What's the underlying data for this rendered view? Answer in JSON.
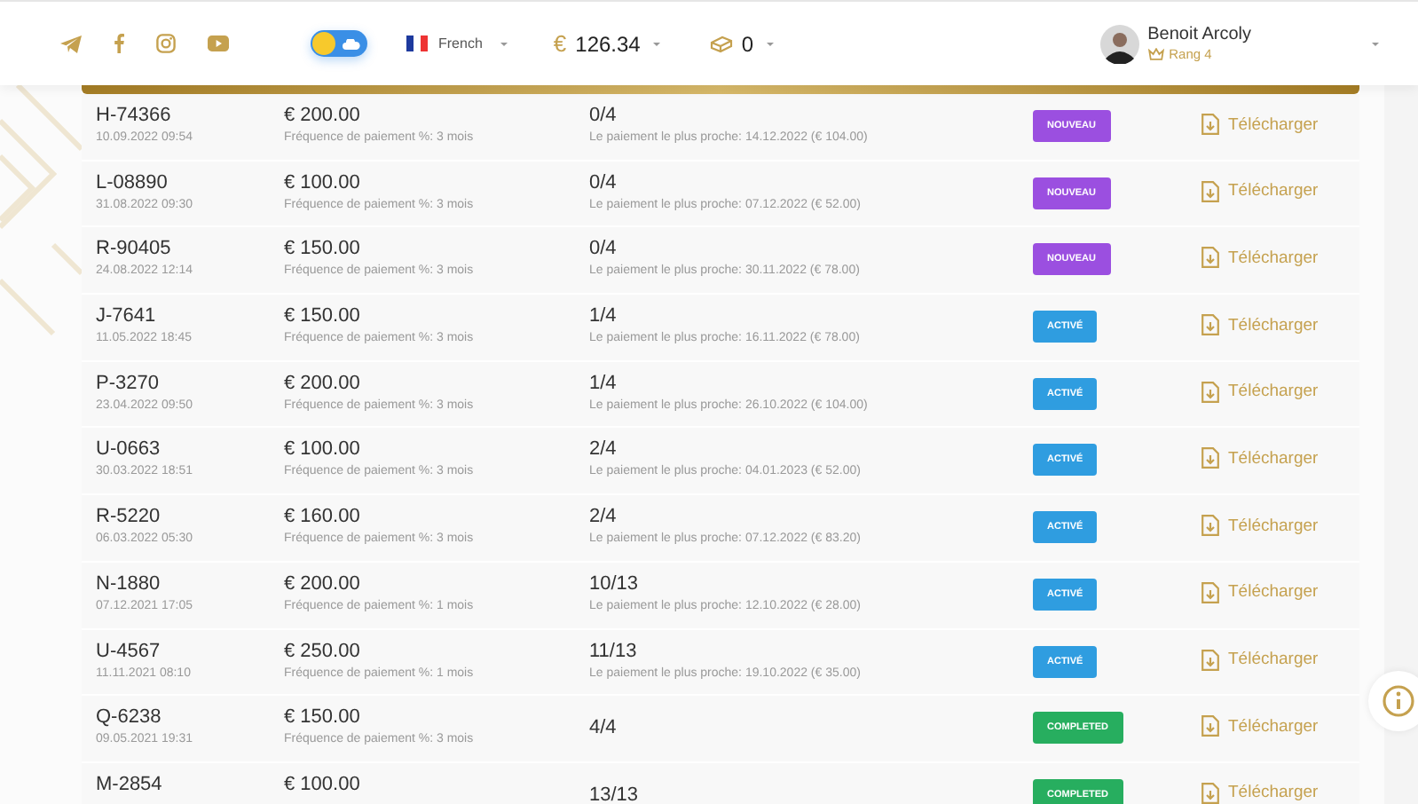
{
  "header": {
    "social": [
      {
        "kind": "telegram"
      },
      {
        "kind": "facebook"
      },
      {
        "kind": "instagram"
      },
      {
        "kind": "youtube"
      }
    ],
    "theme_toggle": {
      "dark": false
    },
    "language": {
      "label": "French"
    },
    "balance": {
      "currency": "€",
      "amount": "126.34"
    },
    "points": {
      "value": "0"
    },
    "user": {
      "name": "Benoit Arcoly",
      "rank": "Rang 4"
    }
  },
  "rows": [
    {
      "id": "H-74366",
      "date": "10.09.2022 09:54",
      "amount": "€ 200.00",
      "frequency": "Fréquence de paiement %: 3 mois",
      "progress": "0/4",
      "next_payment": "Le paiement le plus proche: 14.12.2022 (€ 104.00)",
      "status": {
        "kind": "new",
        "label": "NOUVEAU"
      },
      "download": "Télécharger"
    },
    {
      "id": "L-08890",
      "date": "31.08.2022 09:30",
      "amount": "€ 100.00",
      "frequency": "Fréquence de paiement %: 3 mois",
      "progress": "0/4",
      "next_payment": "Le paiement le plus proche: 07.12.2022 (€ 52.00)",
      "status": {
        "kind": "new",
        "label": "NOUVEAU"
      },
      "download": "Télécharger"
    },
    {
      "id": "R-90405",
      "date": "24.08.2022 12:14",
      "amount": "€ 150.00",
      "frequency": "Fréquence de paiement %: 3 mois",
      "progress": "0/4",
      "next_payment": "Le paiement le plus proche: 30.11.2022 (€ 78.00)",
      "status": {
        "kind": "new",
        "label": "NOUVEAU"
      },
      "download": "Télécharger"
    },
    {
      "id": "J-7641",
      "date": "11.05.2022 18:45",
      "amount": "€ 150.00",
      "frequency": "Fréquence de paiement %: 3 mois",
      "progress": "1/4",
      "next_payment": "Le paiement le plus proche: 16.11.2022 (€ 78.00)",
      "status": {
        "kind": "active",
        "label": "ACTIVÉ"
      },
      "download": "Télécharger"
    },
    {
      "id": "P-3270",
      "date": "23.04.2022 09:50",
      "amount": "€ 200.00",
      "frequency": "Fréquence de paiement %: 3 mois",
      "progress": "1/4",
      "next_payment": "Le paiement le plus proche: 26.10.2022 (€ 104.00)",
      "status": {
        "kind": "active",
        "label": "ACTIVÉ"
      },
      "download": "Télécharger"
    },
    {
      "id": "U-0663",
      "date": "30.03.2022 18:51",
      "amount": "€ 100.00",
      "frequency": "Fréquence de paiement %: 3 mois",
      "progress": "2/4",
      "next_payment": "Le paiement le plus proche: 04.01.2023 (€ 52.00)",
      "status": {
        "kind": "active",
        "label": "ACTIVÉ"
      },
      "download": "Télécharger"
    },
    {
      "id": "R-5220",
      "date": "06.03.2022 05:30",
      "amount": "€ 160.00",
      "frequency": "Fréquence de paiement %: 3 mois",
      "progress": "2/4",
      "next_payment": "Le paiement le plus proche: 07.12.2022 (€ 83.20)",
      "status": {
        "kind": "active",
        "label": "ACTIVÉ"
      },
      "download": "Télécharger"
    },
    {
      "id": "N-1880",
      "date": "07.12.2021 17:05",
      "amount": "€ 200.00",
      "frequency": "Fréquence de paiement %: 1 mois",
      "progress": "10/13",
      "next_payment": "Le paiement le plus proche: 12.10.2022 (€ 28.00)",
      "status": {
        "kind": "active",
        "label": "ACTIVÉ"
      },
      "download": "Télécharger"
    },
    {
      "id": "U-4567",
      "date": "11.11.2021 08:10",
      "amount": "€ 250.00",
      "frequency": "Fréquence de paiement %: 1 mois",
      "progress": "11/13",
      "next_payment": "Le paiement le plus proche: 19.10.2022 (€ 35.00)",
      "status": {
        "kind": "active",
        "label": "ACTIVÉ"
      },
      "download": "Télécharger"
    },
    {
      "id": "Q-6238",
      "date": "09.05.2021 19:31",
      "amount": "€ 150.00",
      "frequency": "Fréquence de paiement %: 3 mois",
      "progress": "4/4",
      "status": {
        "kind": "completed",
        "label": "COMPLETED"
      },
      "download": "Télécharger"
    },
    {
      "id": "M-2854",
      "amount": "€ 100.00",
      "progress": "13/13",
      "status": {
        "kind": "completed",
        "label": "COMPLETED"
      },
      "download": "Télécharger"
    }
  ]
}
